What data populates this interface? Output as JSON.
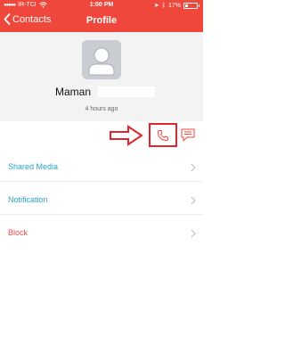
{
  "status_bar": {
    "carrier": "IR-TCI",
    "time": "1:00 PM",
    "battery": "17%"
  },
  "nav": {
    "back_label": "Contacts",
    "title": "Profile"
  },
  "profile": {
    "name": "Maman",
    "last_seen": "4 hours ago"
  },
  "menu": {
    "items": [
      {
        "label": "Shared Media",
        "color": "#2aa3c9"
      },
      {
        "label": "Notification",
        "color": "#2aa3c9"
      },
      {
        "label": "Block",
        "color": "#e84a4a"
      }
    ]
  },
  "colors": {
    "header": "#f0473d",
    "annotation": "#e4232b",
    "accent_blue": "#2aa3c9",
    "danger": "#e84a4a"
  },
  "icons": {
    "call": "phone-icon",
    "chat": "message-icon",
    "back": "chevron-left-icon",
    "chevron": "chevron-right-icon"
  }
}
